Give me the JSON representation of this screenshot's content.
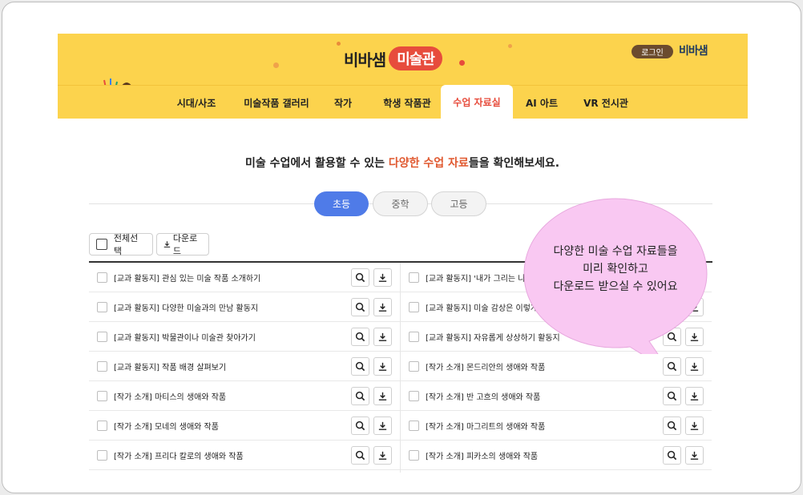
{
  "header": {
    "logo_main": "비바샘",
    "logo_pill": "미술관",
    "login_label": "로그인",
    "brand_small": "비바샘",
    "nav": [
      "시대/사조",
      "미술작품 갤러리",
      "작가",
      "학생 작품관",
      "수업 자료실",
      "AI 아트",
      "VR 전시관"
    ],
    "active_nav": "수업 자료실"
  },
  "headline": {
    "part1": "미술 수업에서 활용할 수 있는 ",
    "highlight": "다양한 수업 자료",
    "part2": "들을 확인해보세요."
  },
  "tabs": [
    "초등",
    "중학",
    "고등"
  ],
  "active_tab": "초등",
  "toolbar": {
    "select_all_label": "전체선택",
    "download_label": "다운로드"
  },
  "left_items": [
    "[교과 활동지] 관심 있는 미술 작품 소개하기",
    "[교과 활동지] 다양한 미술과의 만남 활동지",
    "[교과 활동지] 박물관이나 미술관 찾아가기",
    "[교과 활동지] 작품 배경 살펴보기",
    "[작가 소개] 마티스의 생애와 작품",
    "[작가 소개] 모네의 생애와 작품",
    "[작가 소개] 프리다 칼로의 생애와 작품"
  ],
  "right_items": [
    "[교과 활동지] '내가 그리는 나' 작품 계획서",
    "[교과 활동지] 미술 감상은 이렇게 활동지",
    "[교과 활동지] 자유롭게 상상하기 활동지",
    "[작가 소개] 몬드리안의 생애와 작품",
    "[작가 소개] 반 고흐의 생애와 작품",
    "[작가 소개] 마그리트의 생애와 작품",
    "[작가 소개] 피카소의 생애와 작품"
  ],
  "bubble": {
    "line1": "다양한 미술 수업 자료들을",
    "line2": "미리 확인하고",
    "line3": "다운로드 받으실 수 있어요"
  },
  "colors": {
    "header_bg": "#fcd34d",
    "accent_red": "#e74c3c",
    "tab_active": "#4f7be8",
    "bubble": "#f9c8f2"
  },
  "icons": {
    "preview": "search-icon",
    "download": "download-icon"
  }
}
